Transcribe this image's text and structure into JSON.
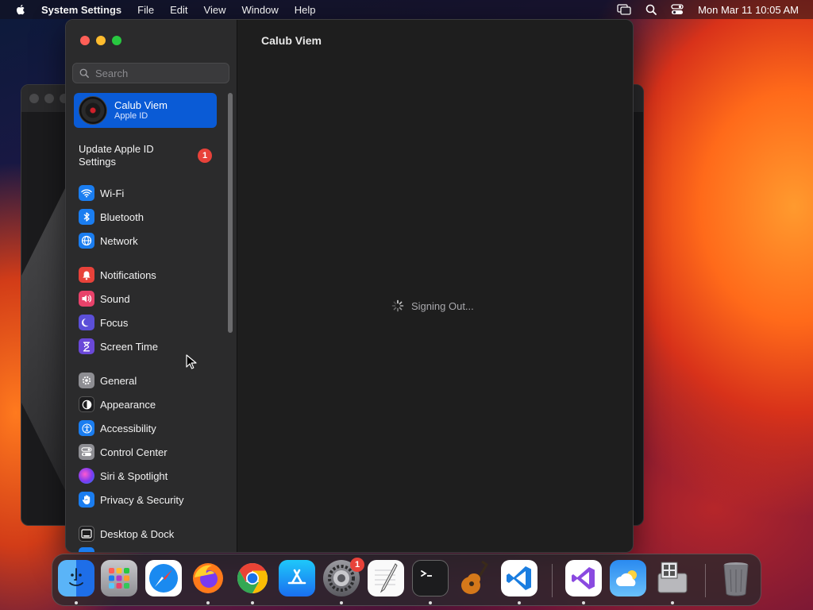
{
  "menubar": {
    "app_name": "System Settings",
    "menus": [
      "File",
      "Edit",
      "View",
      "Window",
      "Help"
    ],
    "clock": "Mon Mar 11  10:05 AM",
    "status_icons": [
      "screen-mirroring-icon",
      "search-icon",
      "control-center-icon"
    ]
  },
  "sidebar": {
    "search_placeholder": "Search",
    "profile": {
      "name": "Calub Viem",
      "subtitle": "Apple ID"
    },
    "update": {
      "label": "Update Apple ID Settings",
      "badge": "1"
    },
    "groups": [
      [
        {
          "label": "Wi-Fi",
          "icon": "wifi-icon",
          "color": "#1a7df0"
        },
        {
          "label": "Bluetooth",
          "icon": "bluetooth-icon",
          "color": "#1a7df0"
        },
        {
          "label": "Network",
          "icon": "network-globe-icon",
          "color": "#1a7df0"
        }
      ],
      [
        {
          "label": "Notifications",
          "icon": "notifications-bell-icon",
          "color": "#e8423a"
        },
        {
          "label": "Sound",
          "icon": "sound-speaker-icon",
          "color": "#e8426a"
        },
        {
          "label": "Focus",
          "icon": "focus-moon-icon",
          "color": "#5b4fd8"
        },
        {
          "label": "Screen Time",
          "icon": "screen-time-hourglass-icon",
          "color": "#6a48d8"
        }
      ],
      [
        {
          "label": "General",
          "icon": "general-gear-icon",
          "color": "#8e8e93"
        },
        {
          "label": "Appearance",
          "icon": "appearance-icon",
          "color": "#1c1c1e"
        },
        {
          "label": "Accessibility",
          "icon": "accessibility-icon",
          "color": "#1a7df0"
        },
        {
          "label": "Control Center",
          "icon": "control-center-icon",
          "color": "#8e8e93"
        },
        {
          "label": "Siri & Spotlight",
          "icon": "siri-icon",
          "color": "#b03ac8"
        },
        {
          "label": "Privacy & Security",
          "icon": "privacy-hand-icon",
          "color": "#1a7df0"
        }
      ],
      [
        {
          "label": "Desktop & Dock",
          "icon": "desktop-dock-icon",
          "color": "#1c1c1e"
        }
      ]
    ]
  },
  "content": {
    "title": "Calub Viem",
    "status": "Signing Out..."
  },
  "dock": {
    "apps": [
      {
        "name": "Finder",
        "icon": "finder-icon",
        "running": true
      },
      {
        "name": "Launchpad",
        "icon": "launchpad-icon",
        "running": false
      },
      {
        "name": "Safari",
        "icon": "safari-icon",
        "running": false
      },
      {
        "name": "Firefox",
        "icon": "firefox-icon",
        "running": true
      },
      {
        "name": "Chrome",
        "icon": "chrome-icon",
        "running": true
      },
      {
        "name": "App Store",
        "icon": "app-store-icon",
        "running": false
      },
      {
        "name": "System Settings",
        "icon": "system-settings-icon",
        "running": true,
        "badge": "1"
      },
      {
        "name": "TextEdit",
        "icon": "textedit-icon",
        "running": false
      },
      {
        "name": "Terminal",
        "icon": "terminal-icon",
        "running": true
      },
      {
        "name": "GarageBand",
        "icon": "garageband-icon",
        "running": false
      },
      {
        "name": "Visual Studio Code",
        "icon": "vscode-icon",
        "running": true
      },
      {
        "name": "Visual Studio",
        "icon": "visual-studio-icon",
        "running": true
      },
      {
        "name": "Weather",
        "icon": "weather-icon",
        "running": false
      },
      {
        "name": "Boot Camp Assistant",
        "icon": "bootcamp-icon",
        "running": true
      },
      {
        "name": "Trash",
        "icon": "trash-icon",
        "running": false
      }
    ]
  }
}
